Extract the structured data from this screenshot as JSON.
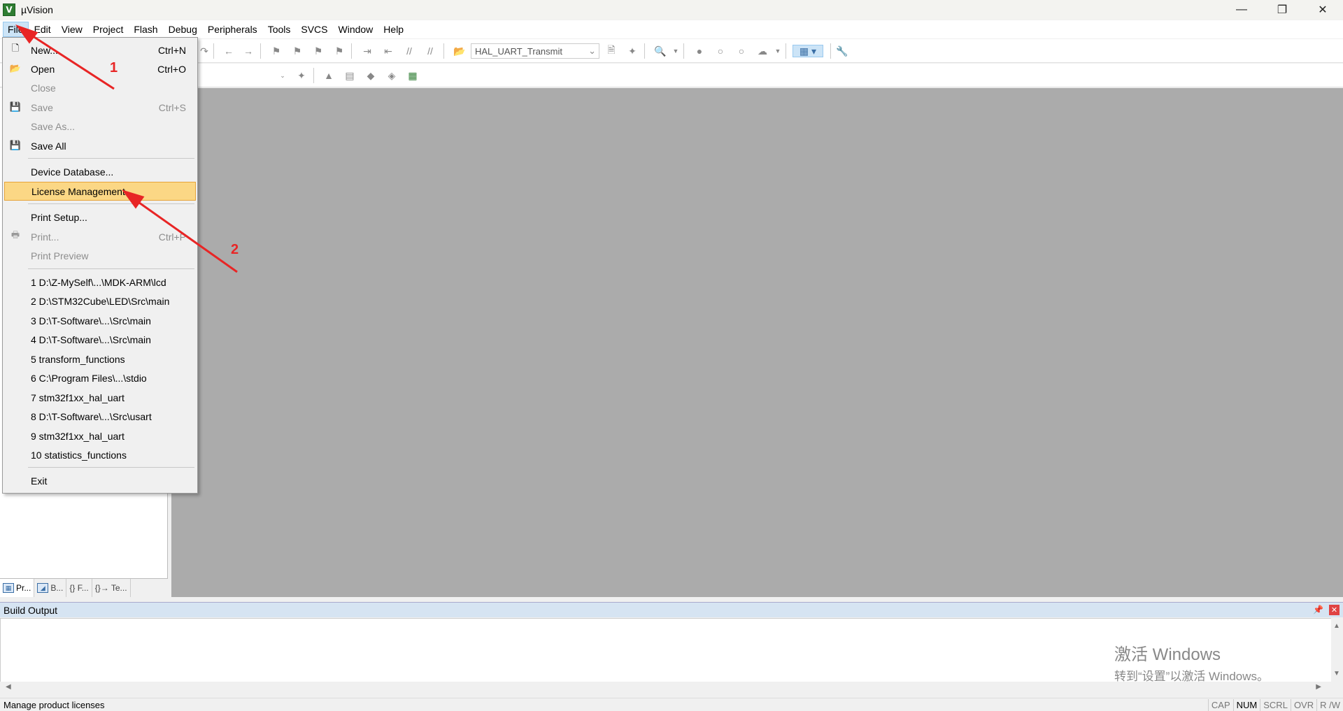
{
  "window": {
    "title": "µVision",
    "app_icon": "uvision-icon",
    "controls": [
      "minimize",
      "restore",
      "close"
    ]
  },
  "menubar": {
    "items": [
      "File",
      "Edit",
      "View",
      "Project",
      "Flash",
      "Debug",
      "Peripherals",
      "Tools",
      "SVCS",
      "Window",
      "Help"
    ],
    "active": "File"
  },
  "toolbar": {
    "target_value": "HAL_UART_Transmit"
  },
  "file_menu": {
    "items": [
      {
        "label": "New...",
        "shortcut": "Ctrl+N",
        "disabled": false,
        "icon": "new-file-icon"
      },
      {
        "label": "Open",
        "shortcut": "Ctrl+O",
        "disabled": false,
        "icon": "open-folder-icon"
      },
      {
        "label": "Close",
        "shortcut": "",
        "disabled": true,
        "icon": ""
      },
      {
        "label": "Save",
        "shortcut": "Ctrl+S",
        "disabled": true,
        "icon": "save-icon"
      },
      {
        "label": "Save As...",
        "shortcut": "",
        "disabled": true,
        "icon": ""
      },
      {
        "label": "Save All",
        "shortcut": "",
        "disabled": false,
        "icon": "save-all-icon"
      },
      {
        "label": "Device Database...",
        "shortcut": "",
        "disabled": false,
        "icon": ""
      },
      {
        "label": "License Management...",
        "shortcut": "",
        "disabled": false,
        "icon": "",
        "highlighted": true
      },
      {
        "label": "Print Setup...",
        "shortcut": "",
        "disabled": false,
        "icon": ""
      },
      {
        "label": "Print...",
        "shortcut": "Ctrl+P",
        "disabled": true,
        "icon": "print-icon"
      },
      {
        "label": "Print Preview",
        "shortcut": "",
        "disabled": true,
        "icon": ""
      }
    ],
    "recent": [
      "1 D:\\Z-MySelf\\...\\MDK-ARM\\lcd",
      "2 D:\\STM32Cube\\LED\\Src\\main",
      "3 D:\\T-Software\\...\\Src\\main",
      "4 D:\\T-Software\\...\\Src\\main",
      "5 transform_functions",
      "6 C:\\Program Files\\...\\stdio",
      "7 stm32f1xx_hal_uart",
      "8 D:\\T-Software\\...\\Src\\usart",
      "9 stm32f1xx_hal_uart",
      "10 statistics_functions"
    ],
    "exit_label": "Exit"
  },
  "left_tabs": [
    {
      "label": "Pr...",
      "icon": "project-icon"
    },
    {
      "label": "B...",
      "icon": "books-icon"
    },
    {
      "label": "{} F...",
      "icon": "functions-icon"
    },
    {
      "label": "{}→ Te...",
      "icon": "templates-icon"
    }
  ],
  "build_output": {
    "title": "Build Output",
    "watermark_line1": "激活 Windows",
    "watermark_line2": "转到“设置”以激活 Windows。"
  },
  "statusbar": {
    "message": "Manage product licenses",
    "indicators": [
      {
        "label": "CAP",
        "on": false
      },
      {
        "label": "NUM",
        "on": true
      },
      {
        "label": "SCRL",
        "on": false
      },
      {
        "label": "OVR",
        "on": false
      },
      {
        "label": "R /W",
        "on": false
      }
    ]
  },
  "annotations": {
    "step1": "1",
    "step2": "2",
    "color": "#e82525"
  }
}
